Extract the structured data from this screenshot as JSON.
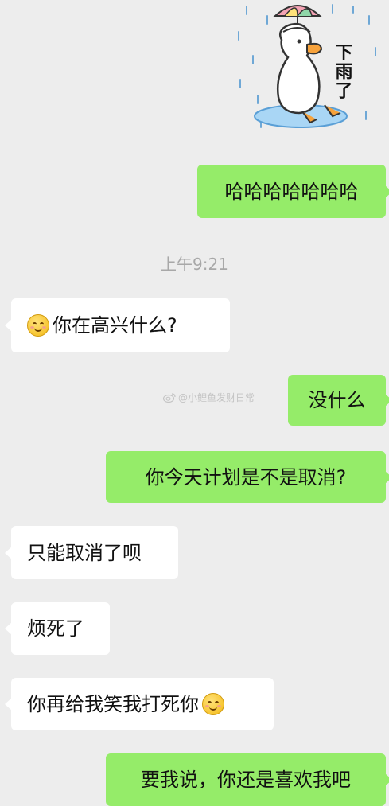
{
  "sticker": {
    "caption": "下雨了",
    "icon": "duck-umbrella-sticker"
  },
  "messages": [
    {
      "side": "out",
      "text": "哈哈哈哈哈哈哈"
    },
    {
      "side": "in",
      "text": "你在高兴什么?",
      "emoji": "smile-emoji"
    },
    {
      "side": "out",
      "text": "没什么"
    },
    {
      "side": "out",
      "text": "你今天计划是不是取消?"
    },
    {
      "side": "in",
      "text": "只能取消了呗"
    },
    {
      "side": "in",
      "text": "烦死了"
    },
    {
      "side": "in",
      "text": "你再给我笑我打死你",
      "emoji": "smile-emoji"
    },
    {
      "side": "out",
      "text": "要我说，你还是喜欢我吧"
    }
  ],
  "timestamp": "上午9:21",
  "watermark": {
    "text": "@小鲤鱼发财日常",
    "icon": "weibo-icon"
  },
  "colors": {
    "background": "#ededed",
    "outgoing_bubble": "#95ec69",
    "incoming_bubble": "#ffffff",
    "timestamp": "#a8a8a8"
  }
}
